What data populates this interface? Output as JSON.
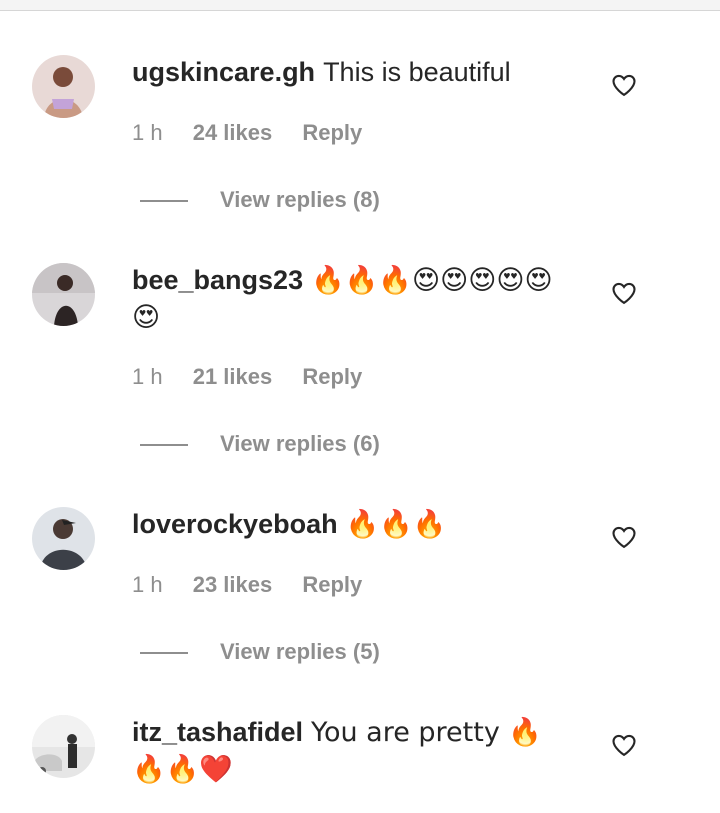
{
  "comments": [
    {
      "username": "ugskincare.gh",
      "text": "This is beautiful",
      "time": "1 h",
      "likes": "24 likes",
      "reply": "Reply",
      "view_replies": "View replies (8)",
      "avatar_icon": "user-avatar",
      "like_icon": "heart-outline-icon"
    },
    {
      "username": "bee_bangs23",
      "text": "🔥🔥🔥😍😍😍😍😍😍",
      "time": "1 h",
      "likes": "21 likes",
      "reply": "Reply",
      "view_replies": "View replies (6)",
      "avatar_icon": "user-avatar",
      "like_icon": "heart-outline-icon"
    },
    {
      "username": "loverockyeboah",
      "text": "🔥🔥🔥",
      "time": "1 h",
      "likes": "23 likes",
      "reply": "Reply",
      "view_replies": "View replies (5)",
      "avatar_icon": "user-avatar",
      "like_icon": "heart-outline-icon"
    },
    {
      "username": "itz_tashafidel",
      "text": "You are pretty 🔥🔥🔥❤️",
      "avatar_icon": "user-avatar",
      "like_icon": "heart-outline-icon"
    }
  ],
  "colors": {
    "text": "#262626",
    "secondary": "#8e8e8e",
    "background": "#ffffff"
  }
}
